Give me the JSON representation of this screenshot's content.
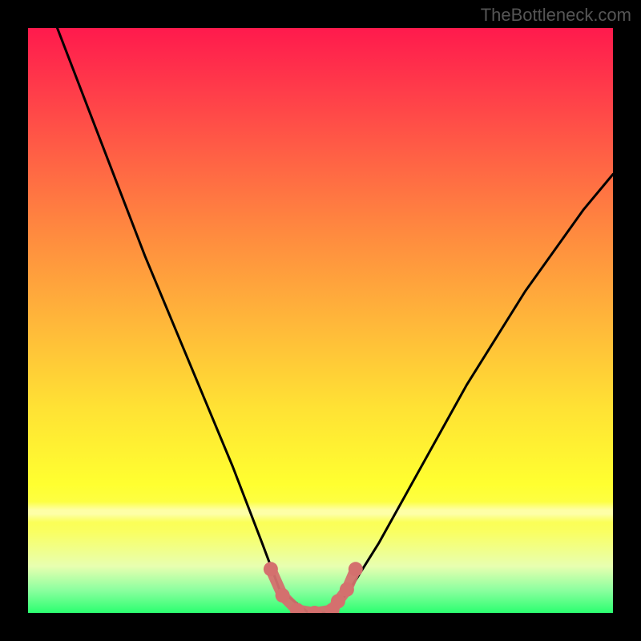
{
  "watermark": "TheBottleneck.com",
  "chart_data": {
    "type": "line",
    "title": "",
    "series": [
      {
        "name": "bottleneck-curve",
        "x": [
          0.05,
          0.1,
          0.15,
          0.2,
          0.25,
          0.3,
          0.35,
          0.4,
          0.43,
          0.48,
          0.52,
          0.55,
          0.6,
          0.65,
          0.7,
          0.75,
          0.8,
          0.85,
          0.9,
          0.95,
          1.0
        ],
        "y": [
          1.0,
          0.87,
          0.74,
          0.61,
          0.49,
          0.37,
          0.25,
          0.12,
          0.04,
          0.0,
          0.0,
          0.04,
          0.12,
          0.21,
          0.3,
          0.39,
          0.47,
          0.55,
          0.62,
          0.69,
          0.75
        ]
      }
    ],
    "xlim": [
      0,
      1
    ],
    "ylim": [
      0,
      1
    ],
    "markers": [
      {
        "x": 0.415,
        "y": 0.075
      },
      {
        "x": 0.435,
        "y": 0.03
      },
      {
        "x": 0.46,
        "y": 0.005
      },
      {
        "x": 0.49,
        "y": 0.0
      },
      {
        "x": 0.52,
        "y": 0.005
      },
      {
        "x": 0.53,
        "y": 0.02
      },
      {
        "x": 0.545,
        "y": 0.04
      },
      {
        "x": 0.56,
        "y": 0.075
      }
    ],
    "marker_color": "#d4706e",
    "curve_color": "#000000"
  }
}
